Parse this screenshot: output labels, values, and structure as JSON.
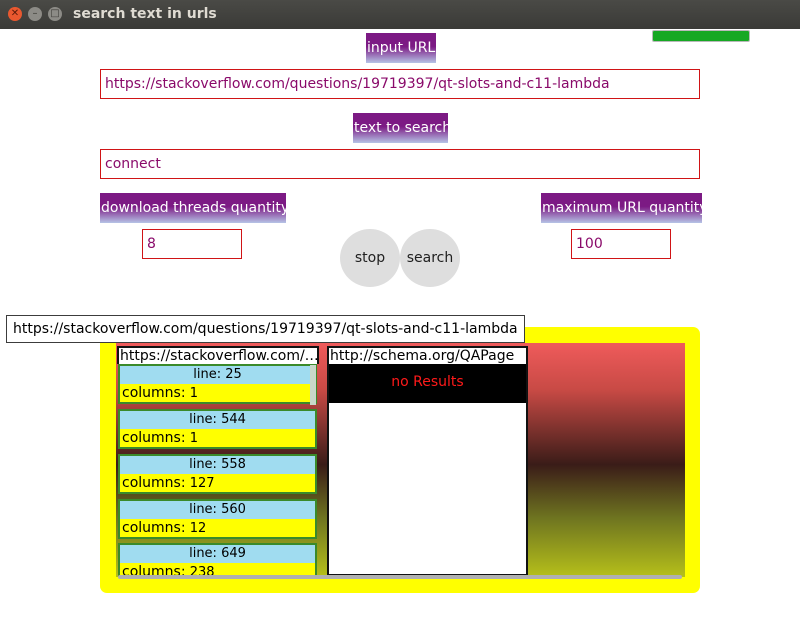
{
  "window": {
    "title": "search text in urls",
    "progress_percent": 100
  },
  "form": {
    "input_url_label": "input URL",
    "input_url_value": "https://stackoverflow.com/questions/19719397/qt-slots-and-c11-lambda",
    "text_to_search_label": "text to search",
    "text_to_search_value": "connect",
    "threads_label": "download threads quantity",
    "threads_value": "8",
    "max_urls_label": "maximum URL quantity",
    "max_urls_value": "100",
    "stop_label": "stop",
    "search_label": "search"
  },
  "tooltip": "https://stackoverflow.com/questions/19719397/qt-slots-and-c11-lambda",
  "results": [
    {
      "url": "https://stackoverflow.com/…",
      "line_prefix": "line:",
      "columns_prefix": "columns:",
      "matches": [
        {
          "line": "25",
          "columns": "1"
        },
        {
          "line": "544",
          "columns": "1"
        },
        {
          "line": "558",
          "columns": "127"
        },
        {
          "line": "560",
          "columns": "12"
        },
        {
          "line": "649",
          "columns": "238"
        }
      ]
    },
    {
      "url": "http://schema.org/QAPage",
      "status": "no Results"
    }
  ]
}
